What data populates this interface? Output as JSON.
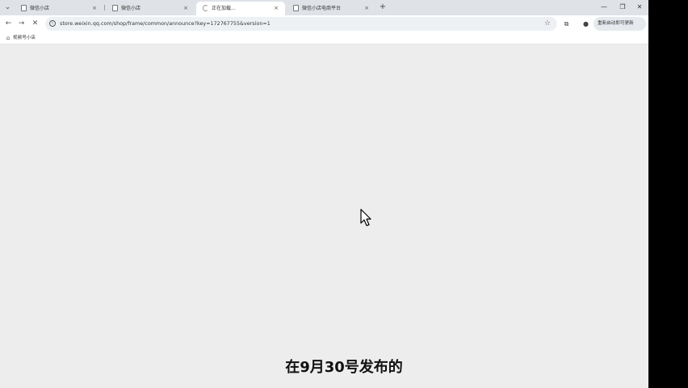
{
  "tabs": [
    {
      "label": "微信小店",
      "active": false
    },
    {
      "label": "微信小店",
      "active": false
    },
    {
      "label": "正在加载...",
      "active": true
    },
    {
      "label": "微信小店电商平台",
      "active": false
    }
  ],
  "tab_close_glyph": "×",
  "new_tab_glyph": "+",
  "window_controls": {
    "minimize": "—",
    "restore": "❐",
    "close": "✕"
  },
  "toolbar": {
    "back_glyph": "←",
    "forward_glyph": "→",
    "stop_glyph": "✕",
    "url": "store.weixin.qq.com/shop/frame/common/announce?key=172767755&version=1",
    "profile_label": "重新启动即可更新"
  },
  "bookmarks": [
    {
      "label": "视频号小店",
      "icon": "shop-icon"
    }
  ],
  "subtitle": "在9月30号发布的",
  "colors": {
    "content_bg": "#ededed",
    "tabstrip_bg": "#dfe3e8",
    "toolbar_bg": "#ffffff"
  }
}
